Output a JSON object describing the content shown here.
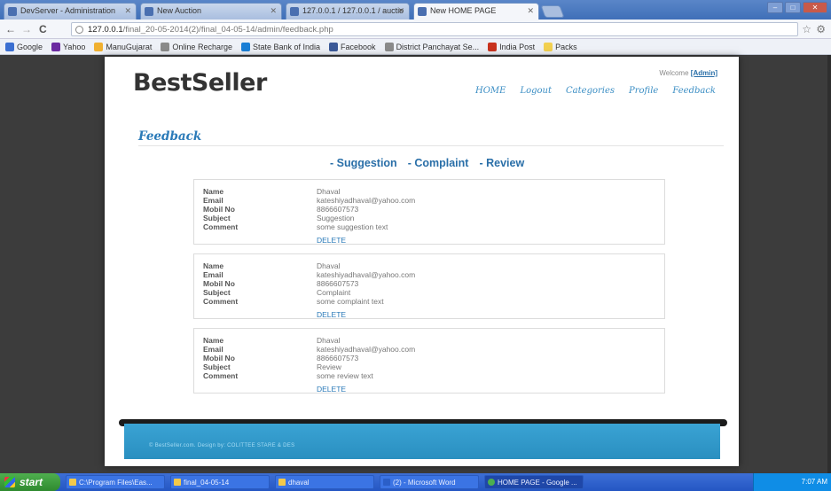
{
  "browser": {
    "tabs": [
      {
        "label": "DevServer - Administration",
        "active": false
      },
      {
        "label": "New Auction",
        "active": false
      },
      {
        "label": "127.0.0.1 / 127.0.0.1 / auctio",
        "active": false
      },
      {
        "label": "New HOME PAGE",
        "active": true
      }
    ],
    "url_host": "127.0.0.1",
    "url_path": "/final_20-05-2014(2)/final_04-05-14/admin/feedback.php",
    "bookmarks": [
      {
        "label": "Google",
        "color": "#3b6fd1"
      },
      {
        "label": "Yahoo",
        "color": "#6b2aa1"
      },
      {
        "label": "ManuGujarat",
        "color": "#f0b030"
      },
      {
        "label": "Online Recharge",
        "color": "#8a8a8a"
      },
      {
        "label": "State Bank of India",
        "color": "#1a7fd6"
      },
      {
        "label": "Facebook",
        "color": "#3b5998"
      },
      {
        "label": "District Panchayat Se...",
        "color": "#8a8a8a"
      },
      {
        "label": "India Post",
        "color": "#c8321e"
      },
      {
        "label": "Packs",
        "color": "#f2d050"
      }
    ]
  },
  "site": {
    "logo": "BestSeller",
    "welcome_prefix": "Welcome",
    "welcome_user": "[Admin]",
    "nav": [
      "HOME",
      "Logout",
      "Categories",
      "Profile",
      "Feedback"
    ],
    "section_title": "Feedback",
    "filters": [
      "- Suggestion",
      "- Complaint",
      "- Review"
    ],
    "labels": {
      "name": "Name",
      "email": "Email",
      "mobile": "Mobil No",
      "subject": "Subject",
      "comment": "Comment"
    },
    "delete_label": "DELETE",
    "feedback": [
      {
        "name": "Dhaval",
        "email": "kateshiyadhaval@yahoo.com",
        "mobile": "8866607573",
        "subject": "Suggestion",
        "comment": "some suggestion text"
      },
      {
        "name": "Dhaval",
        "email": "kateshiyadhaval@yahoo.com",
        "mobile": "8866607573",
        "subject": "Complaint",
        "comment": "some complaint text"
      },
      {
        "name": "Dhaval",
        "email": "kateshiyadhaval@yahoo.com",
        "mobile": "8866607573",
        "subject": "Review",
        "comment": "some review text"
      }
    ],
    "footer_text": "© BestSeller.com. Design by: COLITTEE STARE & DES"
  },
  "taskbar": {
    "start": "start",
    "tasks": [
      {
        "label": "C:\\Program Files\\Eas..."
      },
      {
        "label": "final_04-05-14"
      },
      {
        "label": "dhaval"
      },
      {
        "label": "(2) - Microsoft Word"
      },
      {
        "label": "HOME PAGE - Google ...",
        "active": true
      }
    ],
    "clock": "7:07 AM"
  }
}
